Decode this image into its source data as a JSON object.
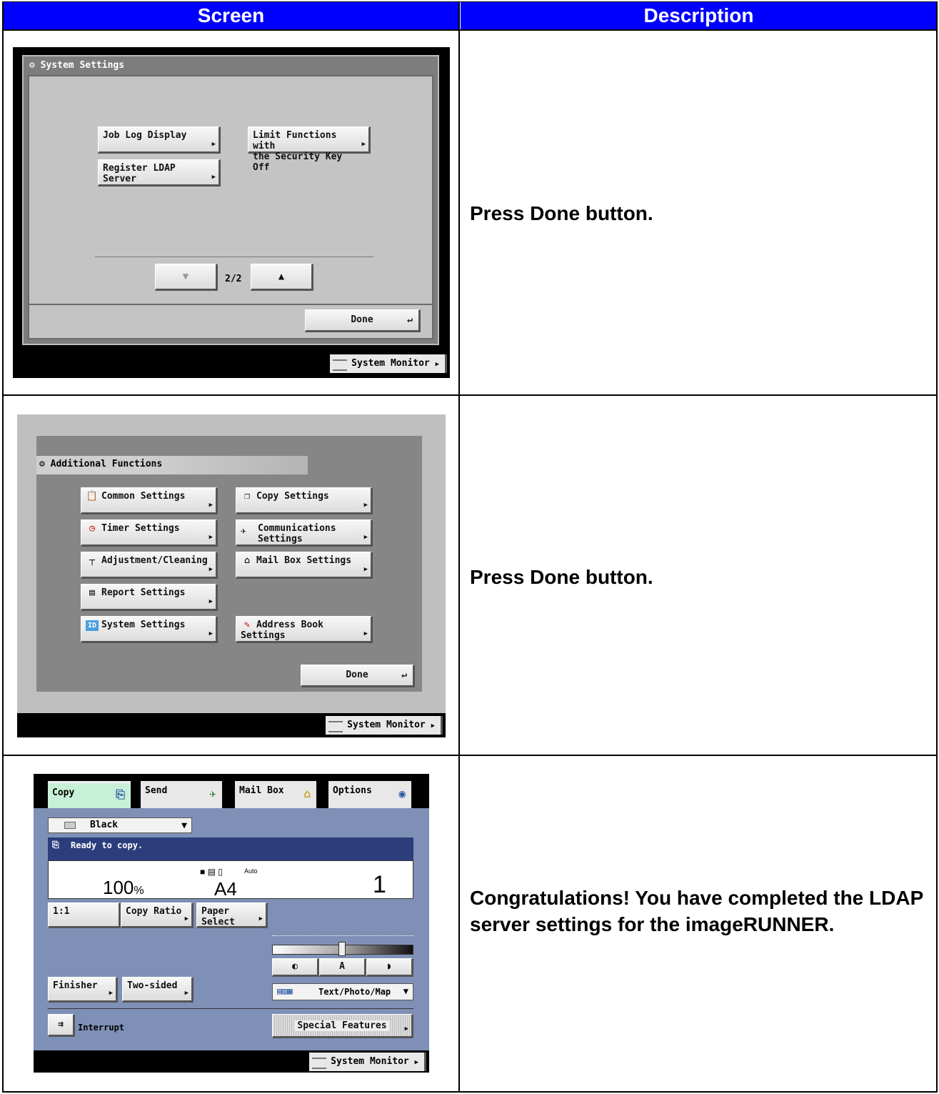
{
  "table": {
    "header_screen": "Screen",
    "header_description": "Description",
    "rows": [
      {
        "description": "Press Done button."
      },
      {
        "description": "Press Done button."
      },
      {
        "description": "Congratulations! You have completed the LDAP server settings for the imageRUNNER."
      }
    ]
  },
  "panel1": {
    "title": "System Settings",
    "btn_job_log": "Job Log Display",
    "btn_limit_l1": "Limit Functions with",
    "btn_limit_l2": "the Security Key Off",
    "btn_register_ldap": "Register LDAP Server",
    "page_indicator": "2/2",
    "done": "Done",
    "system_monitor": "System Monitor"
  },
  "panel2": {
    "title": "Additional Functions",
    "btn_common": "Common Settings",
    "btn_copy": "Copy Settings",
    "btn_timer": "Timer Settings",
    "btn_comm_l1": "Communications",
    "btn_comm_l2": "Settings",
    "btn_adjust": "Adjustment/Cleaning",
    "btn_mailbox": "Mail Box Settings",
    "btn_report": "Report Settings",
    "btn_system": "System Settings",
    "btn_address": "Address Book Settings",
    "done": "Done",
    "system_monitor": "System Monitor"
  },
  "panel3": {
    "tab_copy": "Copy",
    "tab_send": "Send",
    "tab_mailbox": "Mail Box",
    "tab_options": "Options",
    "color_mode": "Black",
    "status": "Ready to copy.",
    "ratio": "100",
    "ratio_unit": "%",
    "paper_auto": "Auto",
    "paper_size": "A4",
    "copies": "1",
    "btn_1to1": "1:1",
    "btn_copy_ratio": "Copy Ratio",
    "btn_paper_select": "Paper Select",
    "density_auto": "A",
    "btn_finisher": "Finisher",
    "btn_two_sided": "Two-sided",
    "image_mode": "Text/Photo/Map",
    "btn_interrupt": "Interrupt",
    "btn_special": "Special Features",
    "system_monitor": "System Monitor"
  }
}
